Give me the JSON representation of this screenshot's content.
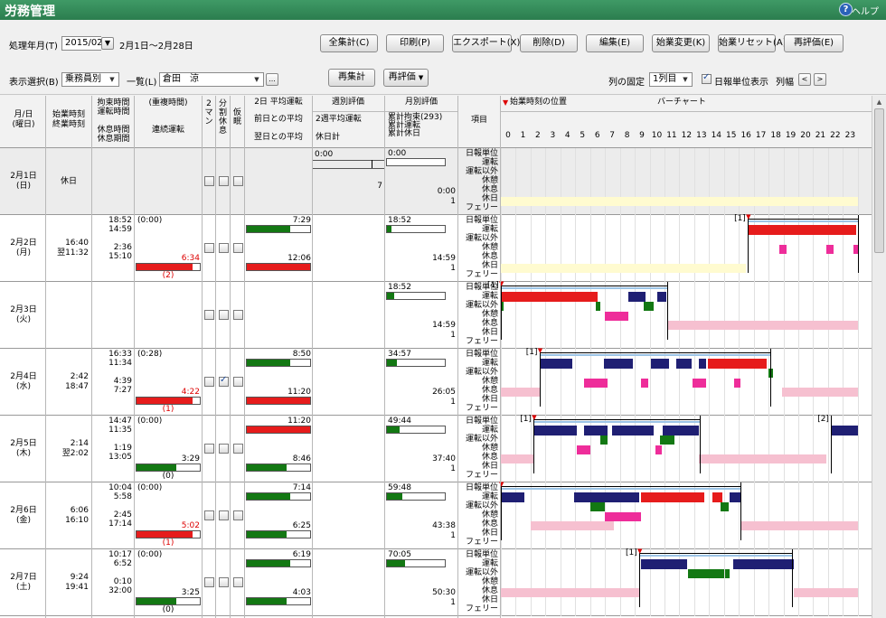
{
  "app": {
    "title": "労務管理",
    "help": "ヘルプ"
  },
  "toolbar": {
    "period_label": "処理年月(T)",
    "period_value": "2015/02",
    "period_range": "2月1日～2月28日",
    "buttons": [
      "全集計(C)",
      "印刷(P)",
      "エクスポート(X)",
      "削除(D)",
      "編集(E)",
      "始業変更(K)",
      "始業リセット(A)",
      "再評価(E)"
    ],
    "display_label": "表示選択(B)",
    "display_value": "乗務員別",
    "list_label": "一覧(L)",
    "list_value": "倉田　涼",
    "ellipsis": "...",
    "recalc": "再集計",
    "reeval": "再評価",
    "col_fix_label": "列の固定",
    "col_fix_value": "1列目",
    "daily_unit_label": "日報単位表示",
    "col_width_label": "列幅"
  },
  "header": {
    "date": "月/日\n(曜日)",
    "startend": "始業時刻\n終業時刻",
    "bind": "拘束時間\n運転時間\n\n休息時間\n休息期間",
    "overlap": "(重複時間)\n\n\n連続運転",
    "twoman": "2\nマ\nン",
    "split": "分\n割\n休\n息",
    "nap": "仮\n眠",
    "avg2": "2日 平均運転",
    "avg2_prev": "前日との平均",
    "avg2_next": "翌日との平均",
    "week": "週別評価",
    "week_avg": "2週平均運転",
    "week_rest": "休日計",
    "month": "月別評価",
    "month_l1": "累計拘束(293)",
    "month_l2": "累計運転",
    "month_l3": "累計休日",
    "item": "項目",
    "start_pos": "始業時刻の位置",
    "barchart": "バーチャート",
    "hours": [
      "0",
      "1",
      "2",
      "3",
      "4",
      "5",
      "6",
      "7",
      "8",
      "9",
      "10",
      "11",
      "12",
      "13",
      "14",
      "15",
      "16",
      "17",
      "18",
      "19",
      "20",
      "21",
      "22",
      "23"
    ]
  },
  "item_labels": [
    "日報単位",
    "運転",
    "運転以外",
    "休憩",
    "休息",
    "休日",
    "フェリー"
  ],
  "days": [
    {
      "date": "2月1日",
      "dow": "(日)",
      "start": "休日",
      "end": "",
      "t1": "",
      "t2": "",
      "t3": "",
      "t4": "",
      "ov": "",
      "cont": "",
      "cont2": "",
      "avg_prev": "",
      "avg_next": "",
      "week_top": "0:00",
      "week_bot": "7",
      "mon_top": "0:00",
      "mon_mid": "0:00",
      "mon_bot": "1",
      "holiday": true,
      "chk": [
        0,
        0,
        0
      ]
    },
    {
      "date": "2月2日",
      "dow": "(月)",
      "start": "16:40",
      "end": "翌11:32",
      "t1": "18:52",
      "t2": "14:59",
      "t3": "2:36",
      "t4": "15:10",
      "ov": "(0:00)",
      "cont": "6:34",
      "cont2": "(2)",
      "avg_prev": "7:29",
      "avg_next": "12:06",
      "week_top": "",
      "week_bot": "",
      "mon_top": "18:52",
      "mon_mid": "14:59",
      "mon_bot": "1",
      "chk": [
        0,
        0,
        0
      ]
    },
    {
      "date": "2月3日",
      "dow": "(火)",
      "start": "",
      "end": "",
      "t1": "",
      "t2": "",
      "t3": "",
      "t4": "",
      "ov": "",
      "cont": "",
      "cont2": "",
      "avg_prev": "",
      "avg_next": "",
      "week_top": "",
      "week_bot": "",
      "mon_top": "18:52",
      "mon_mid": "14:59",
      "mon_bot": "1",
      "chk": [
        0,
        0,
        0
      ]
    },
    {
      "date": "2月4日",
      "dow": "(水)",
      "start": "2:42",
      "end": "18:47",
      "t1": "16:33",
      "t2": "11:34",
      "t3": "4:39",
      "t4": "7:27",
      "ov": "(0:28)",
      "cont": "4:22",
      "cont2": "(1)",
      "avg_prev": "8:50",
      "avg_next": "11:20",
      "week_top": "",
      "week_bot": "",
      "mon_top": "34:57",
      "mon_mid": "26:05",
      "mon_bot": "1",
      "chk": [
        0,
        1,
        0
      ]
    },
    {
      "date": "2月5日",
      "dow": "(木)",
      "start": "2:14",
      "end": "翌2:02",
      "t1": "14:47",
      "t2": "11:35",
      "t3": "1:19",
      "t4": "13:05",
      "ov": "(0:00)",
      "cont": "3:29",
      "cont2": "(0)",
      "avg_prev": "11:20",
      "avg_next": "8:46",
      "week_top": "",
      "week_bot": "",
      "mon_top": "49:44",
      "mon_mid": "37:40",
      "mon_bot": "1",
      "chk": [
        0,
        0,
        0
      ]
    },
    {
      "date": "2月6日",
      "dow": "(金)",
      "start": "6:06",
      "end": "16:10",
      "t1": "10:04",
      "t2": "5:58",
      "t3": "2:45",
      "t4": "17:14",
      "ov": "(0:00)",
      "cont": "5:02",
      "cont2": "(1)",
      "avg_prev": "7:14",
      "avg_next": "6:25",
      "week_top": "",
      "week_bot": "",
      "mon_top": "59:48",
      "mon_mid": "43:38",
      "mon_bot": "1",
      "chk": [
        0,
        0,
        0
      ]
    },
    {
      "date": "2月7日",
      "dow": "(土)",
      "start": "9:24",
      "end": "19:41",
      "t1": "10:17",
      "t2": "6:52",
      "t3": "0:10",
      "t4": "32:00",
      "ov": "(0:00)",
      "cont": "3:25",
      "cont2": "(0)",
      "avg_prev": "6:19",
      "avg_next": "4:03",
      "week_top": "",
      "week_bot": "",
      "mon_top": "70:05",
      "mon_mid": "50:30",
      "mon_bot": "1",
      "chk": [
        0,
        0,
        0
      ]
    }
  ],
  "markers": [
    "[1]",
    "[1]",
    "[1]",
    "[1]",
    "[2]",
    "[1]"
  ],
  "colors": {
    "drive": "#1f1f73",
    "over": "#e61c1c",
    "green": "#137813",
    "rest": "#ee2d9a",
    "holiday": "#f6c0d0",
    "ferry": "#fffbd0",
    "title": "#2e8a55"
  }
}
